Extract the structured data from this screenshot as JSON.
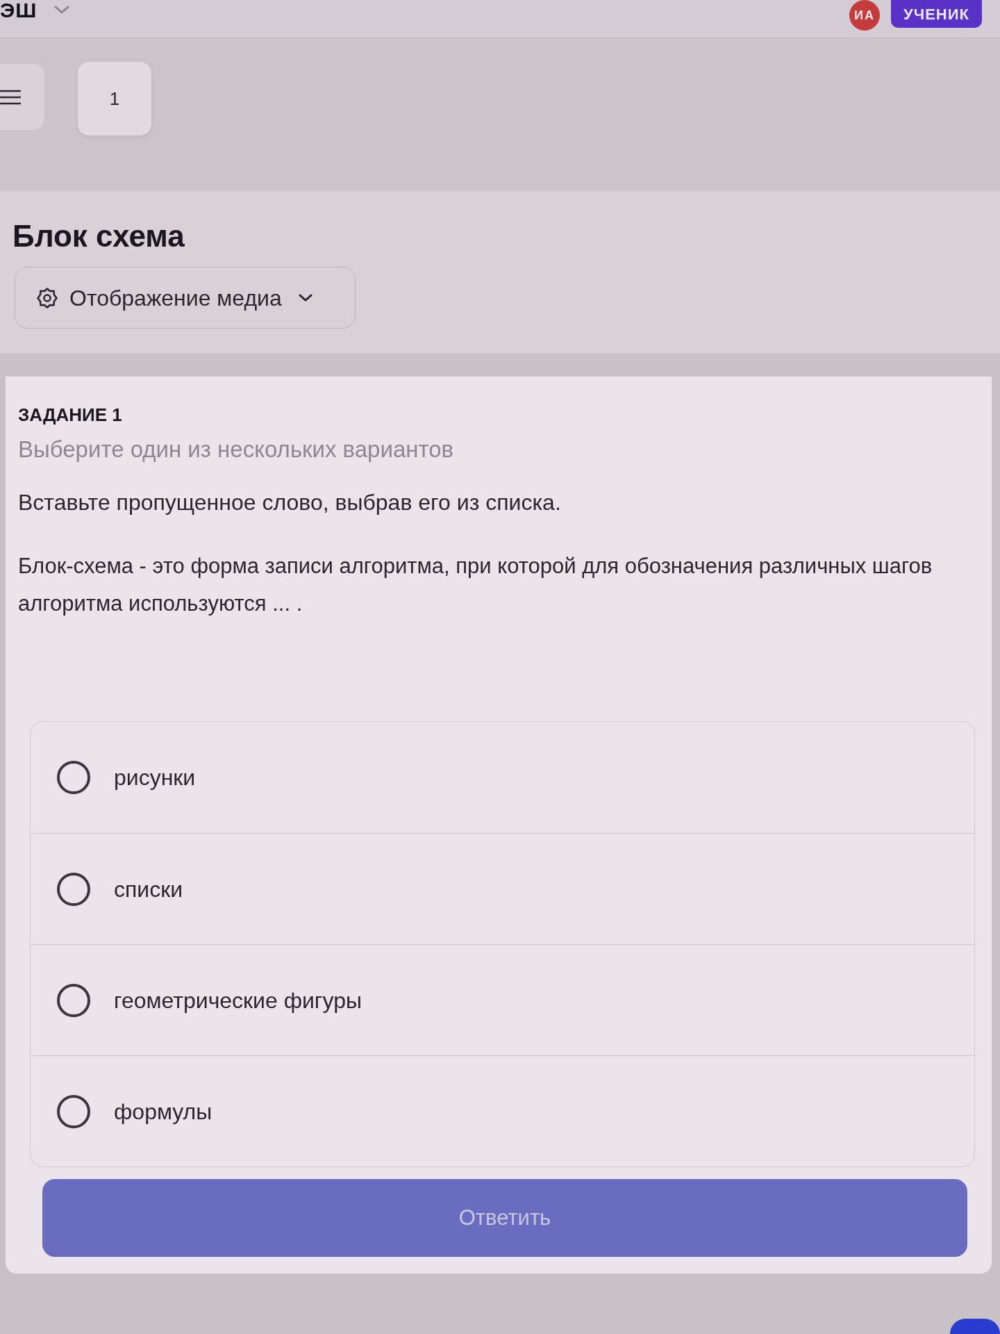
{
  "header": {
    "logo": "ЭШ",
    "avatar_initials": "ИА",
    "role_badge": "УЧЕНИК"
  },
  "toolbar": {
    "task_tabs": [
      {
        "label": "1"
      }
    ]
  },
  "lesson": {
    "title": "Блок схема",
    "media_button": "Отображение медиа"
  },
  "task": {
    "label": "ЗАДАНИЕ 1",
    "hint": "Выберите один из нескольких вариантов",
    "instruction": "Вставьте пропущенное слово, выбрав его из списка.",
    "question": "Блок-схема - это форма записи алгоритма, при которой для обозначения различных шагов алгоритма используются ... .",
    "options": [
      {
        "label": "рисунки",
        "selected": false
      },
      {
        "label": "списки",
        "selected": false
      },
      {
        "label": "геометрические фигуры",
        "selected": false
      },
      {
        "label": "формулы",
        "selected": false
      }
    ],
    "submit_button": {
      "label": "Ответить",
      "disabled": true
    }
  }
}
